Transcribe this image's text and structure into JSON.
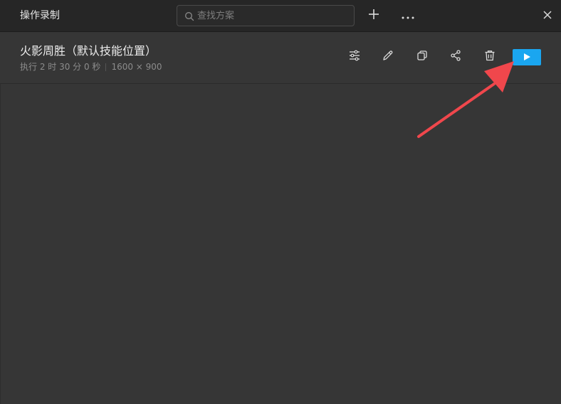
{
  "window": {
    "title": "操作录制"
  },
  "search": {
    "placeholder": "查找方案",
    "value": ""
  },
  "toolbar": {
    "add_icon": "plus-icon",
    "more_icon": "ellipsis-icon",
    "close_icon": "close-icon"
  },
  "plan": {
    "title": "火影周胜（默认技能位置）",
    "duration": "执行 2 时 30 分 0 秒",
    "resolution": "1600 × 900",
    "actions": [
      "settings-sliders-icon",
      "edit-pencil-icon",
      "copy-icon",
      "share-icon",
      "delete-trash-icon",
      "play-icon"
    ]
  },
  "colors": {
    "background": "#363636",
    "titlebar": "#262626",
    "accent": "#1aa6f0",
    "annotation_arrow": "#f0474c"
  }
}
